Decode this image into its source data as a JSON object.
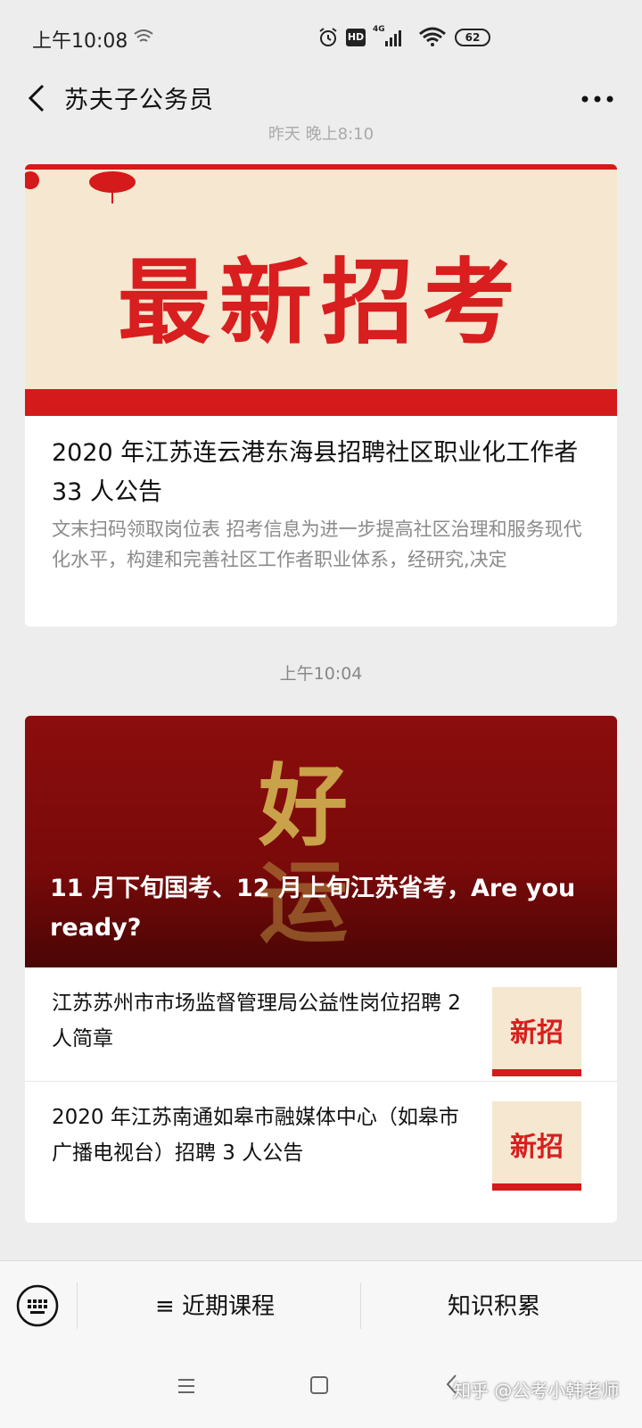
{
  "status_bar": {
    "time": "上午10:08",
    "hd": "HD",
    "network": "4G",
    "battery": "62"
  },
  "nav": {
    "title": "苏夫子公务员"
  },
  "feed": {
    "faded_time": "昨天 晚上8:10",
    "card1": {
      "banner_text": "最新招考",
      "title": "2020 年江苏连云港东海县招聘社区职业化工作者 33 人公告",
      "description": "文末扫码领取岗位表 招考信息为进一步提高社区治理和服务现代化水平，构建和完善社区工作者职业体系，经研究,决定"
    },
    "time2": "上午10:04",
    "card2": {
      "banner_char1": "好",
      "banner_char2": "运",
      "title": "11 月下旬国考、12 月上旬江苏省考，Are you ready?",
      "items": [
        {
          "text": "江苏苏州市市场监督管理局公益性岗位招聘 2 人简章",
          "thumb_text": "新招"
        },
        {
          "text": "2020 年江苏南通如皋市融媒体中心（如皋市广播电视台）招聘 3 人公告",
          "thumb_text": "新招"
        }
      ]
    }
  },
  "menu": {
    "item1": "≡ 近期课程",
    "item2": "知识积累"
  },
  "watermark": "知乎 @公考小韩老师",
  "colors": {
    "background": "#ededed",
    "accent_red": "#d81e1e",
    "banner_dark_red": "#7a0a0a"
  }
}
